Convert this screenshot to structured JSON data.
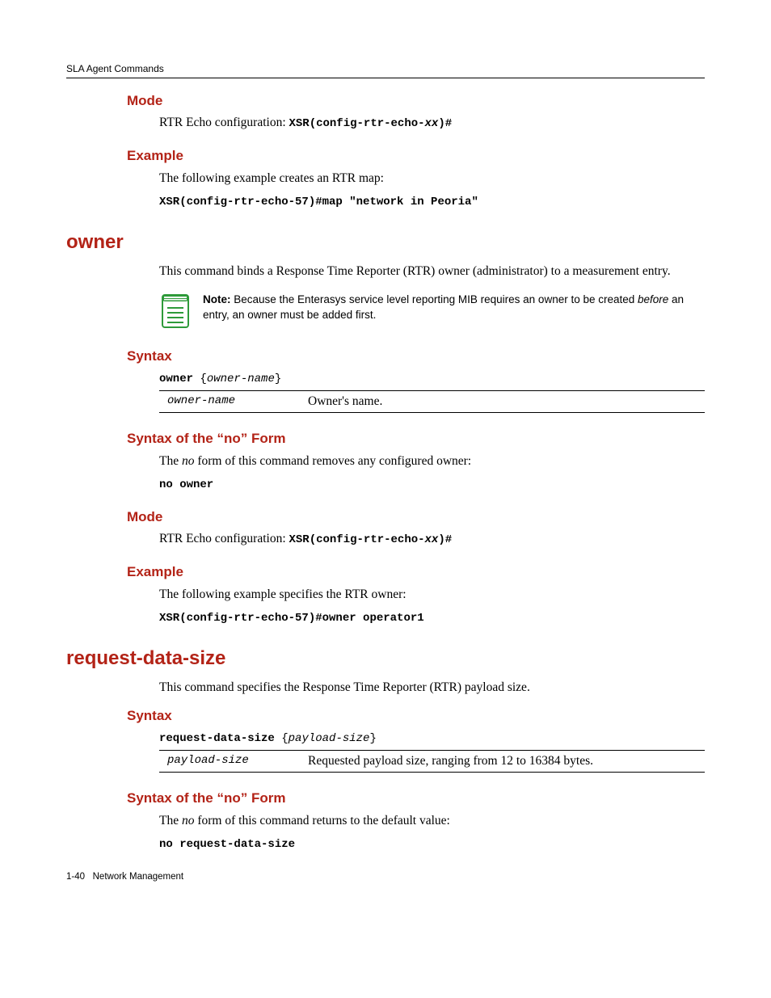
{
  "header": {
    "section": "SLA Agent Commands"
  },
  "footer": {
    "page": "1-40",
    "chapter": "Network Management"
  },
  "s1": {
    "mode_h": "Mode",
    "mode_prefix": "RTR Echo configuration: ",
    "mode_code_a": "XSR(config-rtr-echo-",
    "mode_code_b": "xx",
    "mode_code_c": ")#",
    "example_h": "Example",
    "example_p": "The following example creates an RTR map:",
    "example_code": "XSR(config-rtr-echo-57)#map \"network in Peoria\""
  },
  "owner": {
    "title": "owner",
    "intro": "This command binds a Response Time Reporter (RTR) owner (administrator) to a measurement entry.",
    "note_bold": "Note:",
    "note_a": " Because the Enterasys service level reporting MIB requires an owner to be created ",
    "note_i": "before",
    "note_b": " an entry, an owner must be added first.",
    "syntax_h": "Syntax",
    "syntax_kw": "owner",
    "syntax_arg": "owner-name",
    "param_name": "owner-name",
    "param_desc": "Owner's name.",
    "no_h": "Syntax of the “no” Form",
    "no_p_a": "The ",
    "no_p_i": "no",
    "no_p_b": " form of this command removes any configured owner:",
    "no_code": "no owner",
    "mode_h": "Mode",
    "mode_prefix": "RTR Echo configuration: ",
    "mode_code_a": "XSR(config-rtr-echo-",
    "mode_code_b": "xx",
    "mode_code_c": ")#",
    "example_h": "Example",
    "example_p": "The following example specifies the RTR owner:",
    "example_code": "XSR(config-rtr-echo-57)#owner operator1"
  },
  "rds": {
    "title": "request-data-size",
    "intro": "This command specifies the Response Time Reporter (RTR) payload size.",
    "syntax_h": "Syntax",
    "syntax_kw": "request-data-size",
    "syntax_arg": "payload-size",
    "param_name": "payload-size",
    "param_desc": "Requested payload size, ranging from 12 to 16384 bytes.",
    "no_h": "Syntax of the “no” Form",
    "no_p_a": "The ",
    "no_p_i": "no",
    "no_p_b": " form of this command returns to the default value:",
    "no_code": "no request-data-size"
  }
}
